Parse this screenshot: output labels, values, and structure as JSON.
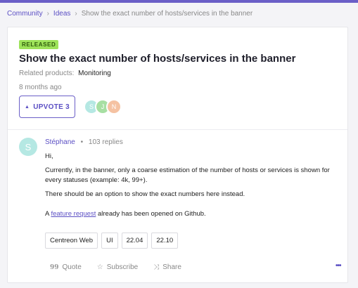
{
  "breadcrumb": {
    "items": [
      "Community",
      "Ideas",
      "Show the exact number of hosts/services in the banner"
    ],
    "separator": "›"
  },
  "post": {
    "status_badge": "RELEASED",
    "title": "Show the exact number of hosts/services in the banner",
    "related_label": "Related products:",
    "related_value": "Monitoring",
    "age": "8 months ago",
    "upvote_icon": "▲",
    "upvote_label": "UPVOTE 3",
    "voters": [
      {
        "initial": "S",
        "color": "#b5e8e3"
      },
      {
        "initial": "J",
        "color": "#a7dfa3"
      },
      {
        "initial": "N",
        "color": "#f5c2a2"
      }
    ]
  },
  "reply": {
    "avatar_initial": "S",
    "author": "Stéphane",
    "dot": "•",
    "replies": "103 replies",
    "greeting": "Hi,",
    "para1": "Currently, in the banner, only a coarse estimation of the number of hosts or services is shown for every statuses (example: 4k, 99+).",
    "para2": "There should be an option to show the exact numbers here instead.",
    "para3_prefix": "A ",
    "para3_link": "feature request",
    "para3_suffix": " already has been opened on Github.",
    "tags": [
      "Centreon Web",
      "UI",
      "22.04",
      "22.10"
    ]
  },
  "actions": {
    "quote": "Quote",
    "quote_icon": "99",
    "subscribe": "Subscribe",
    "subscribe_icon": "☆",
    "share": "Share",
    "share_icon": "⤨",
    "more_icon": "•••"
  },
  "colors": {
    "accent": "#6b5fc7",
    "badge_bg": "#9ee35a"
  }
}
